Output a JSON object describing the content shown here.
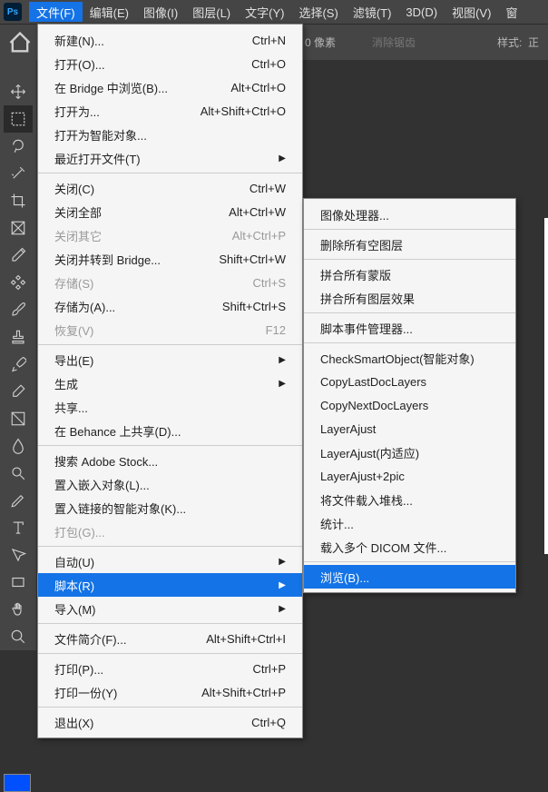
{
  "menubar": {
    "items": [
      "文件(F)",
      "编辑(E)",
      "图像(I)",
      "图层(L)",
      "文字(Y)",
      "选择(S)",
      "滤镜(T)",
      "3D(D)",
      "视图(V)",
      "窗"
    ]
  },
  "options": {
    "pixels": "0 像素",
    "antialias": "消除锯齿",
    "style": "样式:",
    "styleEnd": "正"
  },
  "fileMenu": [
    {
      "label": "新建(N)...",
      "shortcut": "Ctrl+N"
    },
    {
      "label": "打开(O)...",
      "shortcut": "Ctrl+O"
    },
    {
      "label": "在 Bridge 中浏览(B)...",
      "shortcut": "Alt+Ctrl+O"
    },
    {
      "label": "打开为...",
      "shortcut": "Alt+Shift+Ctrl+O"
    },
    {
      "label": "打开为智能对象..."
    },
    {
      "label": "最近打开文件(T)",
      "submenu": true
    },
    {
      "sep": true
    },
    {
      "label": "关闭(C)",
      "shortcut": "Ctrl+W"
    },
    {
      "label": "关闭全部",
      "shortcut": "Alt+Ctrl+W"
    },
    {
      "label": "关闭其它",
      "shortcut": "Alt+Ctrl+P",
      "disabled": true
    },
    {
      "label": "关闭并转到 Bridge...",
      "shortcut": "Shift+Ctrl+W"
    },
    {
      "label": "存储(S)",
      "shortcut": "Ctrl+S",
      "disabled": true
    },
    {
      "label": "存储为(A)...",
      "shortcut": "Shift+Ctrl+S"
    },
    {
      "label": "恢复(V)",
      "shortcut": "F12",
      "disabled": true
    },
    {
      "sep": true
    },
    {
      "label": "导出(E)",
      "submenu": true
    },
    {
      "label": "生成",
      "submenu": true
    },
    {
      "label": "共享..."
    },
    {
      "label": "在 Behance 上共享(D)..."
    },
    {
      "sep": true
    },
    {
      "label": "搜索 Adobe Stock..."
    },
    {
      "label": "置入嵌入对象(L)..."
    },
    {
      "label": "置入链接的智能对象(K)..."
    },
    {
      "label": "打包(G)...",
      "disabled": true
    },
    {
      "sep": true
    },
    {
      "label": "自动(U)",
      "submenu": true
    },
    {
      "label": "脚本(R)",
      "submenu": true,
      "highlighted": true
    },
    {
      "label": "导入(M)",
      "submenu": true
    },
    {
      "sep": true
    },
    {
      "label": "文件简介(F)...",
      "shortcut": "Alt+Shift+Ctrl+I"
    },
    {
      "sep": true
    },
    {
      "label": "打印(P)...",
      "shortcut": "Ctrl+P"
    },
    {
      "label": "打印一份(Y)",
      "shortcut": "Alt+Shift+Ctrl+P"
    },
    {
      "sep": true
    },
    {
      "label": "退出(X)",
      "shortcut": "Ctrl+Q"
    }
  ],
  "scriptsMenu": [
    {
      "label": "图像处理器..."
    },
    {
      "sep": true
    },
    {
      "label": "删除所有空图层"
    },
    {
      "sep": true
    },
    {
      "label": "拼合所有蒙版"
    },
    {
      "label": "拼合所有图层效果"
    },
    {
      "sep": true
    },
    {
      "label": "脚本事件管理器..."
    },
    {
      "sep": true
    },
    {
      "label": "CheckSmartObject(智能对象)"
    },
    {
      "label": "CopyLastDocLayers"
    },
    {
      "label": "CopyNextDocLayers"
    },
    {
      "label": "LayerAjust"
    },
    {
      "label": "LayerAjust(内适应)"
    },
    {
      "label": "LayerAjust+2pic"
    },
    {
      "label": "将文件载入堆栈..."
    },
    {
      "label": "统计..."
    },
    {
      "label": "载入多个 DICOM 文件..."
    },
    {
      "sep": true
    },
    {
      "label": "浏览(B)...",
      "highlighted": true
    }
  ],
  "tools": [
    "move",
    "marquee",
    "lasso",
    "wand",
    "crop",
    "frame",
    "eyedropper",
    "heal",
    "brush",
    "stamp",
    "history",
    "eraser",
    "gradient",
    "blur",
    "dodge",
    "pen",
    "type",
    "path",
    "rect",
    "hand",
    "zoom"
  ]
}
